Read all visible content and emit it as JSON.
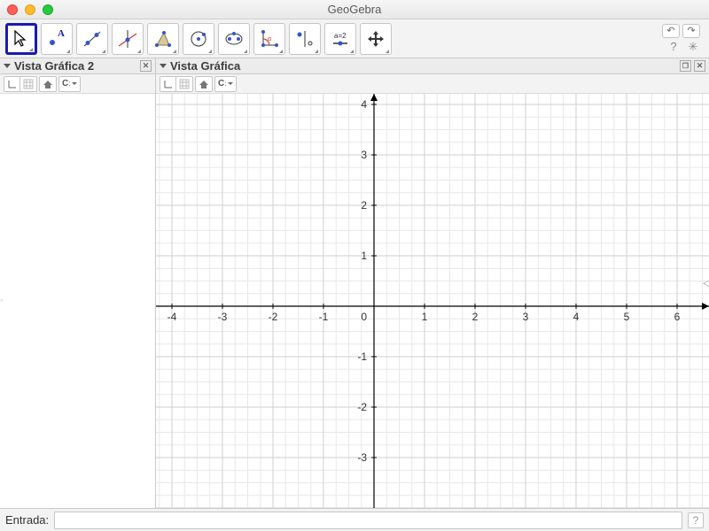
{
  "window": {
    "title": "GeoGebra"
  },
  "toolbar": {
    "tools": [
      {
        "name": "move-tool",
        "selected": true
      },
      {
        "name": "point-tool",
        "selected": false
      },
      {
        "name": "line-tool",
        "selected": false
      },
      {
        "name": "perpendicular-tool",
        "selected": false
      },
      {
        "name": "polygon-tool",
        "selected": false
      },
      {
        "name": "circle-tool",
        "selected": false
      },
      {
        "name": "ellipse-tool",
        "selected": false
      },
      {
        "name": "angle-tool",
        "selected": false
      },
      {
        "name": "reflect-tool",
        "selected": false
      },
      {
        "name": "slider-tool",
        "selected": false
      },
      {
        "name": "move-view-tool",
        "selected": false
      }
    ]
  },
  "panels": {
    "left": {
      "title": "Vista Gráfica 2"
    },
    "right": {
      "title": "Vista Gráfica"
    }
  },
  "graph": {
    "x_ticks": [
      -4,
      -3,
      -2,
      -1,
      0,
      1,
      2,
      3,
      4,
      5,
      6
    ],
    "y_ticks": [
      -3,
      -2,
      -1,
      1,
      2,
      3,
      4
    ],
    "origin_label": "0"
  },
  "input": {
    "label": "Entrada:",
    "value": ""
  }
}
